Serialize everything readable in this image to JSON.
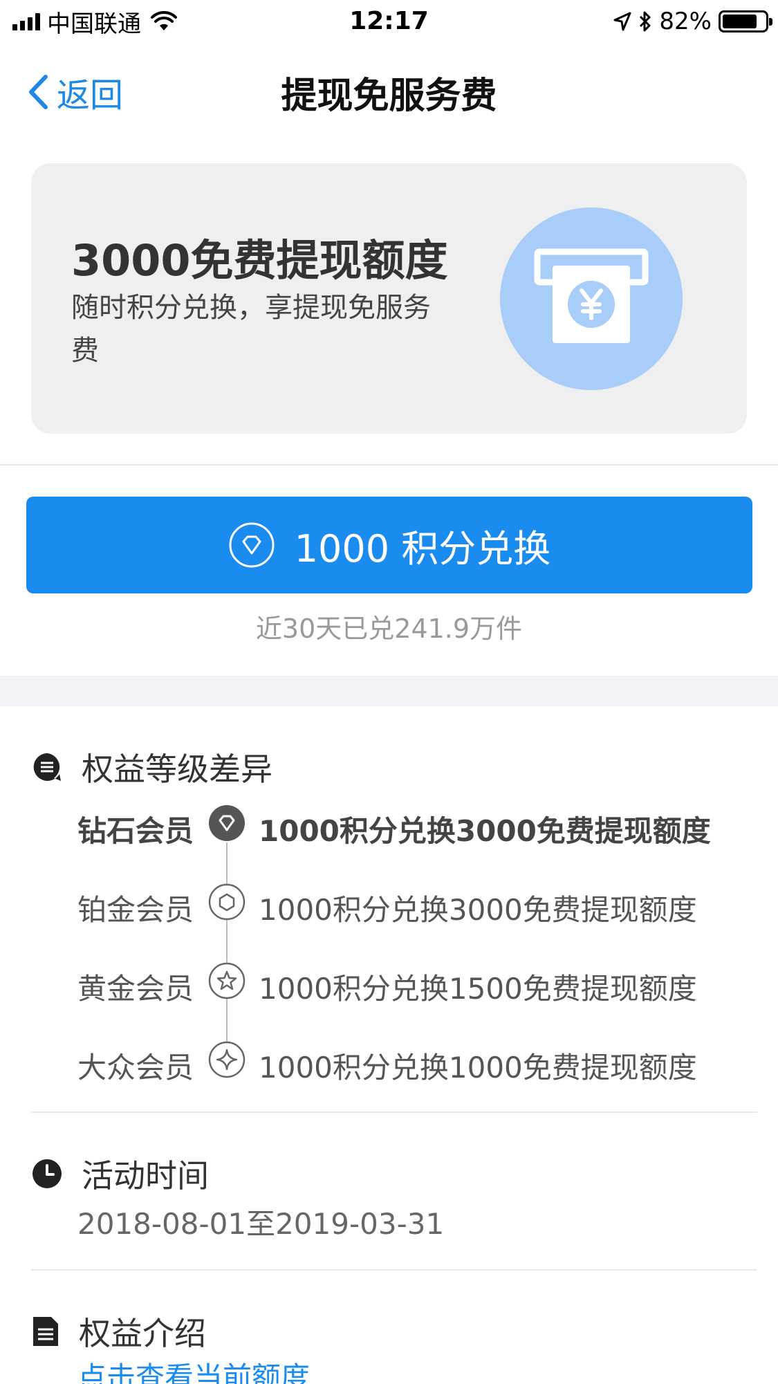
{
  "status_bar": {
    "carrier": "中国联通",
    "time": "12:17",
    "battery_percent": "82%",
    "battery_level": 0.82,
    "icons": [
      "signal-icon",
      "wifi-icon",
      "location-icon",
      "bluetooth-icon",
      "battery-icon"
    ]
  },
  "nav": {
    "back_label": "返回",
    "title": "提现免服务费"
  },
  "hero": {
    "title": "3000免费提现额度",
    "subtitle": "随时积分兑换，享提现免服务费",
    "icon": "atm-yuan-icon"
  },
  "exchange": {
    "button_label": "1000 积分兑换",
    "button_icon": "diamond-icon",
    "exchanged_text": "近30天已兑241.9万件"
  },
  "tiers_section": {
    "title": "权益等级差异",
    "icon": "message-icon",
    "tiers": [
      {
        "name": "钻石会员",
        "desc": "1000积分兑换3000免费提现额度",
        "icon": "diamond-icon",
        "current": true
      },
      {
        "name": "铂金会员",
        "desc": "1000积分兑换3000免费提现额度",
        "icon": "hexagon-icon",
        "current": false
      },
      {
        "name": "黄金会员",
        "desc": "1000积分兑换1500免费提现额度",
        "icon": "star-icon",
        "current": false
      },
      {
        "name": "大众会员",
        "desc": "1000积分兑换1000免费提现额度",
        "icon": "sparkle-icon",
        "current": false
      }
    ]
  },
  "time_section": {
    "title": "活动时间",
    "icon": "clock-icon",
    "range": "2018-08-01至2019-03-31"
  },
  "intro_section": {
    "title": "权益介绍",
    "icon": "document-icon",
    "link_text": "点击查看当前额度"
  },
  "colors": {
    "accent": "#1a8cf0",
    "hero_bg": "#efefef",
    "hero_circle": "#a8cdf8"
  }
}
